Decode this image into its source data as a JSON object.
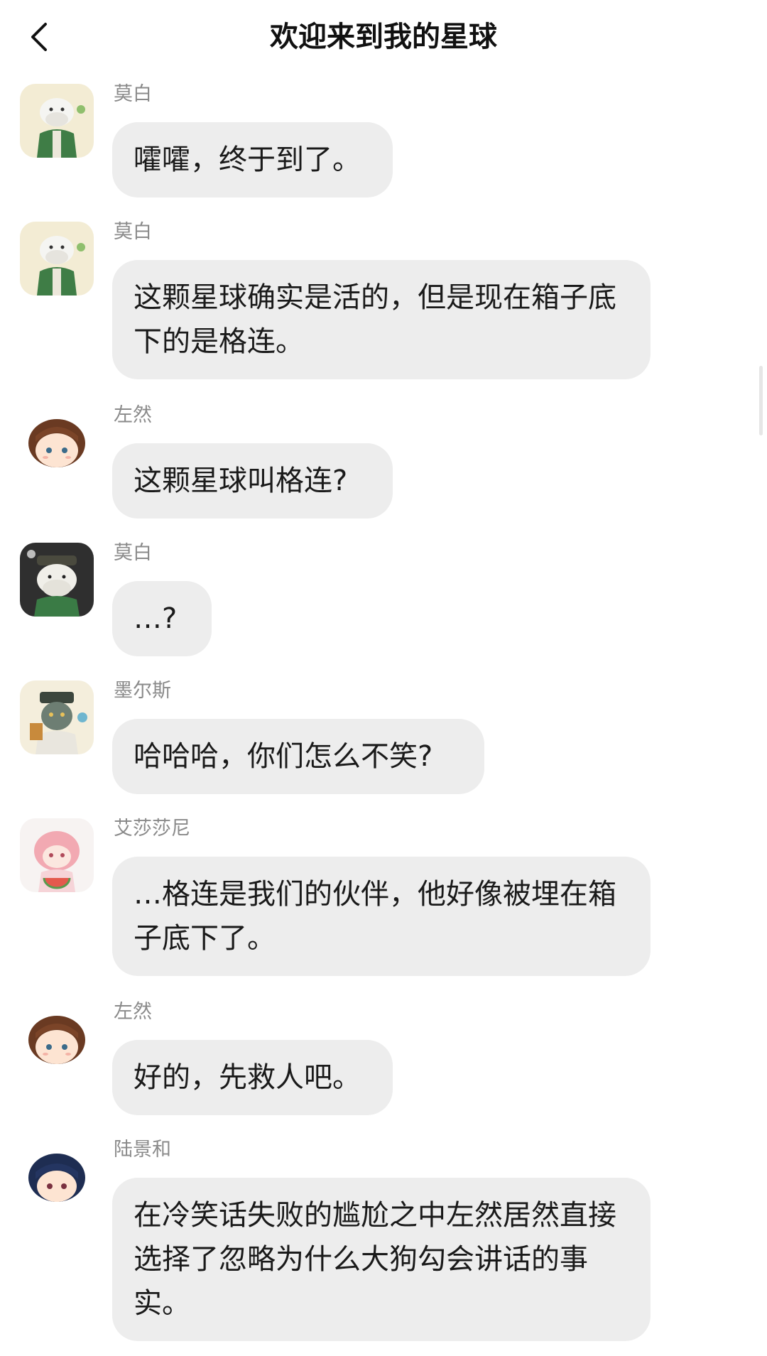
{
  "header": {
    "title": "欢迎来到我的星球",
    "back_icon": "chevron-left-icon"
  },
  "messages": [
    {
      "sender": "莫白",
      "text": "嚯嚯，终于到了。",
      "avatar": "white-dog-green-jacket"
    },
    {
      "sender": "莫白",
      "text": "这颗星球确实是活的，但是现在箱子底下的是格连。",
      "avatar": "white-dog-green-jacket"
    },
    {
      "sender": "左然",
      "text": "这颗星球叫格连?",
      "avatar": "brown-hair-boy"
    },
    {
      "sender": "莫白",
      "text": "…?",
      "avatar": "white-dog-dark-hat"
    },
    {
      "sender": "墨尔斯",
      "text": "哈哈哈，你们怎么不笑?",
      "avatar": "dark-hat-character"
    },
    {
      "sender": "艾莎莎尼",
      "text": "…格连是我们的伙伴，他好像被埋在箱子底下了。",
      "avatar": "pink-hair-character"
    },
    {
      "sender": "左然",
      "text": "好的，先救人吧。",
      "avatar": "brown-hair-boy"
    },
    {
      "sender": "陆景和",
      "text": "在冷笑话失败的尴尬之中左然居然直接选择了忽略为什么大狗勾会讲话的事实。",
      "avatar": "navy-hair-boy"
    }
  ],
  "colors": {
    "bubble": "#ededed",
    "sender": "#8a8a8a",
    "text": "#1a1a1a"
  }
}
